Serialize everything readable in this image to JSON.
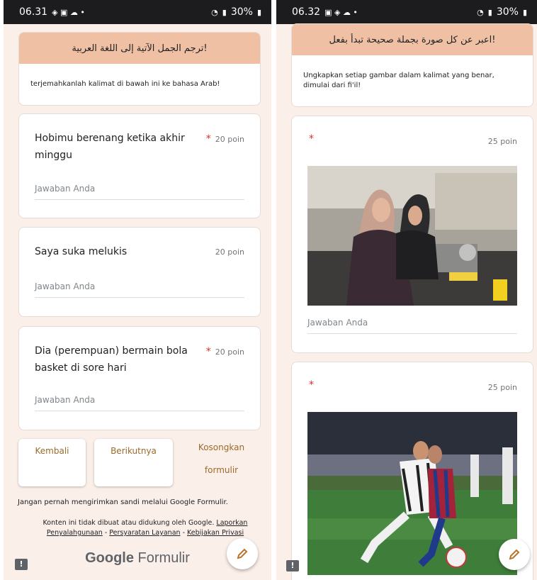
{
  "left": {
    "status": {
      "time": "06.31",
      "battery": "30%"
    },
    "header": {
      "title": "!ترجم الجمل الآتية إلى اللغة العربية",
      "description": "terjemahkanlah kalimat di bawah ini ke bahasa Arab!"
    },
    "questions": [
      {
        "title": "Hobimu berenang ketika akhir minggu",
        "required_mark": "*",
        "points": "20 poin",
        "placeholder": "Jawaban Anda"
      },
      {
        "title": "Saya suka melukis",
        "points": "20 poin",
        "placeholder": "Jawaban Anda"
      },
      {
        "title": "Dia (perempuan) bermain bola basket di sore hari",
        "required_mark": "*",
        "points": "20 poin",
        "placeholder": "Jawaban Anda"
      }
    ],
    "buttons": {
      "back": "Kembali",
      "next": "Berikutnya",
      "clear_line1": "Kosongkan",
      "clear_line2": "formulir"
    },
    "footer": {
      "note": "Jangan pernah mengirimkan sandi melalui Google Formulir.",
      "legal_prefix": "Konten ini tidak dibuat atau didukung oleh Google.",
      "link_report": "Laporkan Penyalahgunaan",
      "sep1": " - ",
      "link_terms": "Persyaratan Layanan",
      "sep2": " - ",
      "link_privacy": "Kebijakan Privasi",
      "logo_brand": "Google",
      "logo_product": "Formulir"
    }
  },
  "right": {
    "status": {
      "time": "06.32",
      "battery": "30%"
    },
    "header": {
      "title": "!اعبر عن كل صورة بجملة صحيحة تبدأ بفعل",
      "description": "Ungkapkan setiap gambar dalam kalimat yang benar, dimulai dari fi'il!"
    },
    "questions": [
      {
        "required_mark": "*",
        "points": "25 poin",
        "image": "photo of two women cooking in a kitchen",
        "placeholder": "Jawaban Anda"
      },
      {
        "required_mark": "*",
        "points": "25 poin",
        "image": "photo of football players on a pitch"
      }
    ]
  },
  "colors": {
    "accent": "#efc0a4",
    "background": "#fbefe9",
    "button_text": "#9a6a2b",
    "required": "#d93025"
  },
  "icons": [
    "report-icon",
    "edit-pencil-icon",
    "wifi-icon",
    "signal-icon",
    "battery-icon"
  ]
}
